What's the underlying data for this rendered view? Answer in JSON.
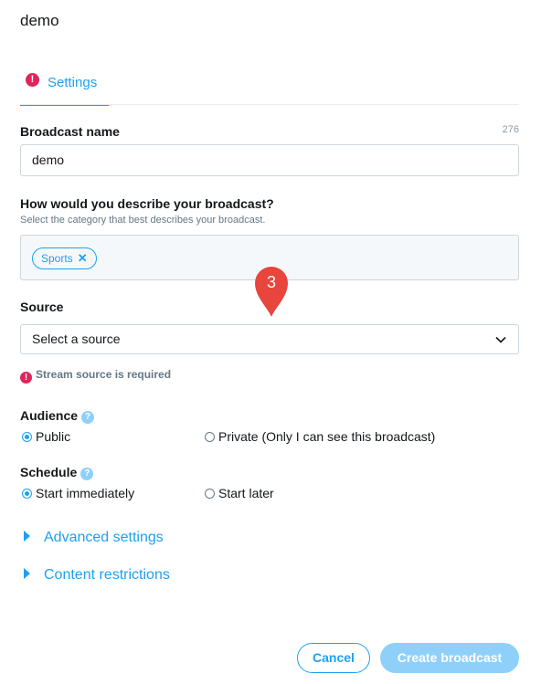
{
  "page": {
    "title": "demo"
  },
  "tabs": [
    {
      "label": "Settings",
      "icon": "alert-icon",
      "active": true
    }
  ],
  "broadcast_name": {
    "label": "Broadcast name",
    "counter": "276",
    "value": "demo"
  },
  "category": {
    "label": "How would you describe your broadcast?",
    "hint": "Select the category that best describes your broadcast.",
    "chips": [
      {
        "label": "Sports",
        "remove": "✕"
      }
    ]
  },
  "source": {
    "label": "Source",
    "placeholder": "Select a source",
    "error": "Stream source is required"
  },
  "audience": {
    "label": "Audience",
    "options": [
      {
        "label": "Public",
        "selected": true
      },
      {
        "label": "Private (Only I can see this broadcast)",
        "selected": false
      }
    ]
  },
  "schedule": {
    "label": "Schedule",
    "options": [
      {
        "label": "Start immediately",
        "selected": true
      },
      {
        "label": "Start later",
        "selected": false
      }
    ]
  },
  "expanders": [
    {
      "label": "Advanced settings"
    },
    {
      "label": "Content restrictions"
    }
  ],
  "actions": {
    "cancel": "Cancel",
    "create": "Create broadcast"
  },
  "annotation": {
    "number": "3",
    "color": "#e8453c"
  },
  "icons": {
    "alert": "!",
    "help": "?"
  },
  "colors": {
    "accent": "#1da1f2",
    "error": "#e0245e",
    "disabled_accent": "#8ed0f9"
  }
}
